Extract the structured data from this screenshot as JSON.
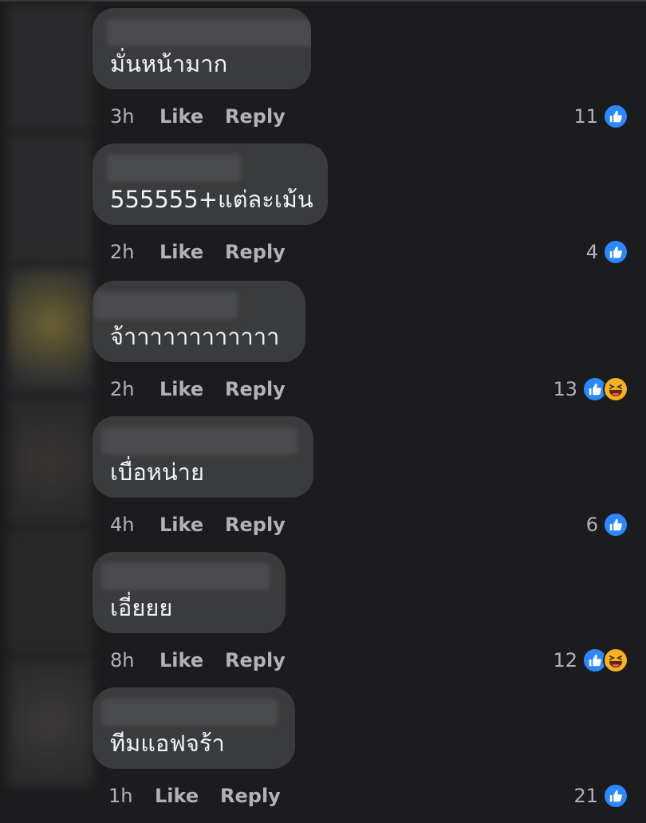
{
  "comments": [
    {
      "text": "มั่นหน้ามาก",
      "time": "3h",
      "like_label": "Like",
      "reply_label": "Reply",
      "reaction_count": "11",
      "reactions": [
        "like-icon"
      ]
    },
    {
      "text": "555555+แต่ละเม้น",
      "time": "2h",
      "like_label": "Like",
      "reply_label": "Reply",
      "reaction_count": "4",
      "reactions": [
        "like-icon"
      ]
    },
    {
      "text": "จ้าาาาาาาาาาาา",
      "time": "2h",
      "like_label": "Like",
      "reply_label": "Reply",
      "reaction_count": "13",
      "reactions": [
        "like-icon",
        "haha-icon"
      ]
    },
    {
      "text": "เบื่อหน่าย",
      "time": "4h",
      "like_label": "Like",
      "reply_label": "Reply",
      "reaction_count": "6",
      "reactions": [
        "like-icon"
      ]
    },
    {
      "text": "เอี่ยยย",
      "time": "8h",
      "like_label": "Like",
      "reply_label": "Reply",
      "reaction_count": "12",
      "reactions": [
        "like-icon",
        "haha-icon"
      ]
    },
    {
      "text": "ทีมแอฟจร้า",
      "time": "1h",
      "like_label": "Like",
      "reply_label": "Reply",
      "reaction_count": "21",
      "reactions": [
        "like-icon"
      ]
    }
  ],
  "colors": {
    "background": "#1c1c1e",
    "bubble": "#3a3b3c",
    "like_blue": "#2d88ff",
    "haha_yellow": "#f7b125",
    "meta_text": "#b0b3b8"
  }
}
